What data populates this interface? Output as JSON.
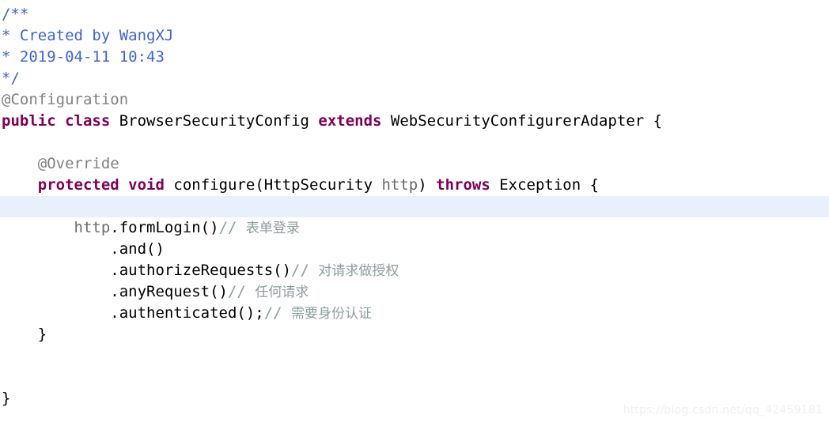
{
  "editor": {
    "background_color": "#ffffff",
    "highlight_color": "#e8f0fb",
    "colors": {
      "javadoc": "#3f63d6",
      "annotation": "#808080",
      "keyword": "#7f0055",
      "plain": "#000000",
      "parameter": "#6a6a6a",
      "comment": "#8d9e9e",
      "watermark": "#efefef"
    }
  },
  "code": {
    "language": "java",
    "lines": [
      {
        "n": 1,
        "indent": 0,
        "highlighted": false,
        "tokens": [
          {
            "kind": "javadoc",
            "text": "/**"
          }
        ]
      },
      {
        "n": 2,
        "indent": 0,
        "highlighted": false,
        "tokens": [
          {
            "kind": "javadoc",
            "text": "* Created by WangXJ"
          }
        ]
      },
      {
        "n": 3,
        "indent": 0,
        "highlighted": false,
        "tokens": [
          {
            "kind": "javadoc",
            "text": "* 2019-04-11 10:43"
          }
        ]
      },
      {
        "n": 4,
        "indent": 0,
        "highlighted": false,
        "tokens": [
          {
            "kind": "javadoc",
            "text": "*/"
          }
        ]
      },
      {
        "n": 5,
        "indent": 0,
        "highlighted": false,
        "tokens": [
          {
            "kind": "annotation",
            "text": "@Configuration"
          }
        ]
      },
      {
        "n": 6,
        "indent": 0,
        "highlighted": false,
        "tokens": [
          {
            "kind": "keyword",
            "text": "public"
          },
          {
            "kind": "plain",
            "text": " "
          },
          {
            "kind": "keyword",
            "text": "class"
          },
          {
            "kind": "plain",
            "text": " BrowserSecurityConfig "
          },
          {
            "kind": "keyword",
            "text": "extends"
          },
          {
            "kind": "plain",
            "text": " WebSecurityConfigurerAdapter {"
          }
        ]
      },
      {
        "n": 7,
        "indent": 0,
        "highlighted": false,
        "tokens": []
      },
      {
        "n": 8,
        "indent": 0,
        "highlighted": false,
        "tokens": [
          {
            "kind": "annotation",
            "text": "    @Override"
          }
        ]
      },
      {
        "n": 9,
        "indent": 0,
        "highlighted": false,
        "tokens": [
          {
            "kind": "keyword",
            "text": "    protected"
          },
          {
            "kind": "plain",
            "text": " "
          },
          {
            "kind": "keyword",
            "text": "void"
          },
          {
            "kind": "plain",
            "text": " configure(HttpSecurity "
          },
          {
            "kind": "parameter",
            "text": "http"
          },
          {
            "kind": "plain",
            "text": ") "
          },
          {
            "kind": "keyword",
            "text": "throws"
          },
          {
            "kind": "plain",
            "text": " Exception {"
          }
        ]
      },
      {
        "n": 10,
        "indent": 0,
        "highlighted": true,
        "tokens": []
      },
      {
        "n": 11,
        "indent": 0,
        "highlighted": false,
        "tokens": [
          {
            "kind": "parameter",
            "text": "        http"
          },
          {
            "kind": "plain",
            "text": ".formLogin()"
          },
          {
            "kind": "comment",
            "text": "// "
          },
          {
            "kind": "cjk",
            "text": "表单登录"
          }
        ]
      },
      {
        "n": 12,
        "indent": 0,
        "highlighted": false,
        "tokens": [
          {
            "kind": "plain",
            "text": "            .and()"
          }
        ]
      },
      {
        "n": 13,
        "indent": 0,
        "highlighted": false,
        "tokens": [
          {
            "kind": "plain",
            "text": "            .authorizeRequests()"
          },
          {
            "kind": "comment",
            "text": "// "
          },
          {
            "kind": "cjk",
            "text": "对请求做授权"
          }
        ]
      },
      {
        "n": 14,
        "indent": 0,
        "highlighted": false,
        "tokens": [
          {
            "kind": "plain",
            "text": "            .anyRequest()"
          },
          {
            "kind": "comment",
            "text": "// "
          },
          {
            "kind": "cjk",
            "text": "任何请求"
          }
        ]
      },
      {
        "n": 15,
        "indent": 0,
        "highlighted": false,
        "tokens": [
          {
            "kind": "plain",
            "text": "            .authenticated();"
          },
          {
            "kind": "comment",
            "text": "// "
          },
          {
            "kind": "cjk",
            "text": "需要身份认证"
          }
        ]
      },
      {
        "n": 16,
        "indent": 0,
        "highlighted": false,
        "tokens": [
          {
            "kind": "plain",
            "text": "    }"
          }
        ]
      },
      {
        "n": 17,
        "indent": 0,
        "highlighted": false,
        "tokens": []
      },
      {
        "n": 18,
        "indent": 0,
        "highlighted": false,
        "tokens": []
      },
      {
        "n": 19,
        "indent": 0,
        "highlighted": false,
        "tokens": [
          {
            "kind": "plain",
            "text": "}"
          }
        ]
      }
    ]
  },
  "watermark": {
    "text": "https://blog.csdn.net/qq_42459181"
  }
}
